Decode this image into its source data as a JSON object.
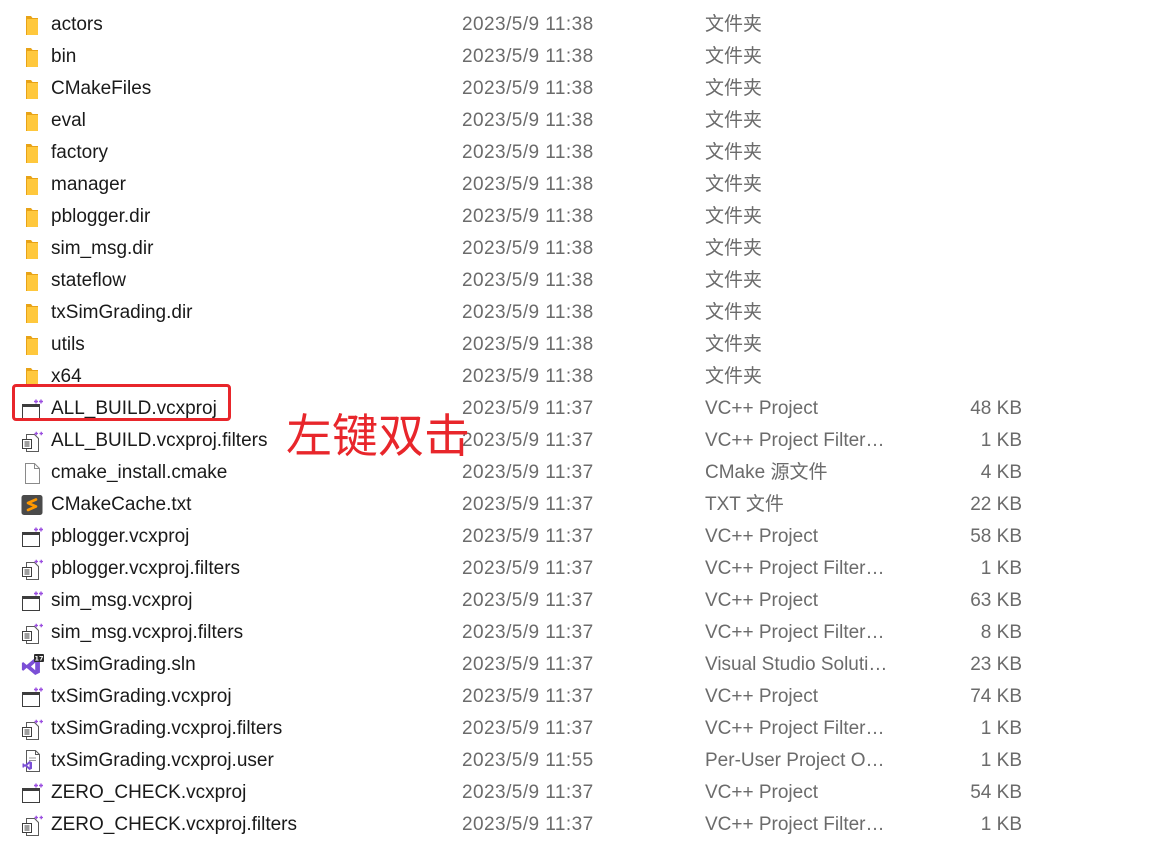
{
  "rows": [
    {
      "name": "actors",
      "date": "2023/5/9 11:38",
      "type": "文件夹",
      "icon": "folder-icon"
    },
    {
      "name": "bin",
      "date": "2023/5/9 11:38",
      "type": "文件夹",
      "icon": "folder-icon"
    },
    {
      "name": "CMakeFiles",
      "date": "2023/5/9 11:38",
      "type": "文件夹",
      "icon": "folder-icon"
    },
    {
      "name": "eval",
      "date": "2023/5/9 11:38",
      "type": "文件夹",
      "icon": "folder-icon"
    },
    {
      "name": "factory",
      "date": "2023/5/9 11:38",
      "type": "文件夹",
      "icon": "folder-icon"
    },
    {
      "name": "manager",
      "date": "2023/5/9 11:38",
      "type": "文件夹",
      "icon": "folder-icon"
    },
    {
      "name": "pblogger.dir",
      "date": "2023/5/9 11:38",
      "type": "文件夹",
      "icon": "folder-icon"
    },
    {
      "name": "sim_msg.dir",
      "date": "2023/5/9 11:38",
      "type": "文件夹",
      "icon": "folder-icon"
    },
    {
      "name": "stateflow",
      "date": "2023/5/9 11:38",
      "type": "文件夹",
      "icon": "folder-icon"
    },
    {
      "name": "txSimGrading.dir",
      "date": "2023/5/9 11:38",
      "type": "文件夹",
      "icon": "folder-icon"
    },
    {
      "name": "utils",
      "date": "2023/5/9 11:38",
      "type": "文件夹",
      "icon": "folder-icon"
    },
    {
      "name": "x64",
      "date": "2023/5/9 11:38",
      "type": "文件夹",
      "icon": "folder-icon"
    },
    {
      "name": "ALL_BUILD.vcxproj",
      "date": "2023/5/9 11:37",
      "type": "VC++ Project",
      "size": "48 KB",
      "icon": "vcxproj-file-icon"
    },
    {
      "name": "ALL_BUILD.vcxproj.filters",
      "date": "2023/5/9 11:37",
      "type": "VC++ Project Filter…",
      "size": "1 KB",
      "icon": "filters-file-icon"
    },
    {
      "name": "cmake_install.cmake",
      "date": "2023/5/9 11:37",
      "type": "CMake 源文件",
      "size": "4 KB",
      "icon": "cmake-file-icon"
    },
    {
      "name": "CMakeCache.txt",
      "date": "2023/5/9 11:37",
      "type": "TXT 文件",
      "size": "22 KB",
      "icon": "txt-file-icon"
    },
    {
      "name": "pblogger.vcxproj",
      "date": "2023/5/9 11:37",
      "type": "VC++ Project",
      "size": "58 KB",
      "icon": "vcxproj-file-icon"
    },
    {
      "name": "pblogger.vcxproj.filters",
      "date": "2023/5/9 11:37",
      "type": "VC++ Project Filter…",
      "size": "1 KB",
      "icon": "filters-file-icon"
    },
    {
      "name": "sim_msg.vcxproj",
      "date": "2023/5/9 11:37",
      "type": "VC++ Project",
      "size": "63 KB",
      "icon": "vcxproj-file-icon"
    },
    {
      "name": "sim_msg.vcxproj.filters",
      "date": "2023/5/9 11:37",
      "type": "VC++ Project Filter…",
      "size": "8 KB",
      "icon": "filters-file-icon"
    },
    {
      "name": "txSimGrading.sln",
      "date": "2023/5/9 11:37",
      "type": "Visual Studio Soluti…",
      "size": "23 KB",
      "icon": "sln-file-icon",
      "icon_badge": "17"
    },
    {
      "name": "txSimGrading.vcxproj",
      "date": "2023/5/9 11:37",
      "type": "VC++ Project",
      "size": "74 KB",
      "icon": "vcxproj-file-icon"
    },
    {
      "name": "txSimGrading.vcxproj.filters",
      "date": "2023/5/9 11:37",
      "type": "VC++ Project Filter…",
      "size": "1 KB",
      "icon": "filters-file-icon"
    },
    {
      "name": "txSimGrading.vcxproj.user",
      "date": "2023/5/9 11:55",
      "type": "Per-User Project O…",
      "size": "1 KB",
      "icon": "user-file-icon"
    },
    {
      "name": "ZERO_CHECK.vcxproj",
      "date": "2023/5/9 11:37",
      "type": "VC++ Project",
      "size": "54 KB",
      "icon": "vcxproj-file-icon"
    },
    {
      "name": "ZERO_CHECK.vcxproj.filters",
      "date": "2023/5/9 11:37",
      "type": "VC++ Project Filter…",
      "size": "1 KB",
      "icon": "filters-file-icon"
    }
  ],
  "annotation": {
    "text": "左键双击",
    "target": "ALL_BUILD.vcxproj",
    "color": "#e8262b"
  },
  "colors": {
    "name_text": "#1a1a1a",
    "detail_text": "#6b6b6b",
    "folder": "#ffc83d",
    "vs_purple": "#7b4fd6"
  }
}
